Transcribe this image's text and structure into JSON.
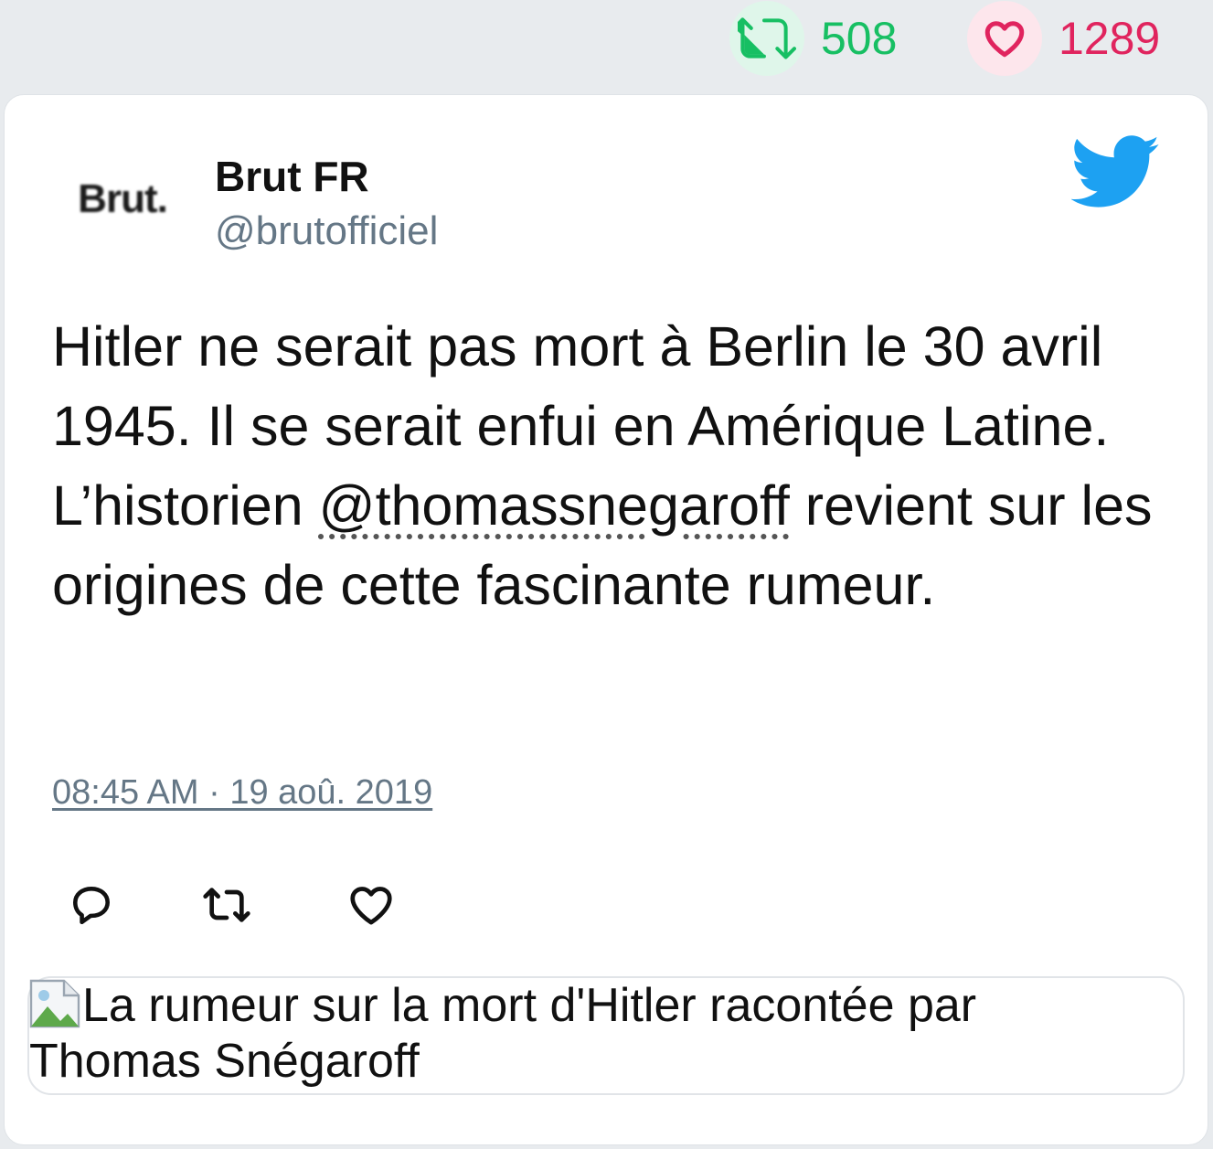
{
  "stats": {
    "retweets": "508",
    "likes": "1289",
    "retweet_icon": "retweet-icon",
    "like_icon": "heart-icon",
    "retweet_color": "#17bf63",
    "like_color": "#e0245e"
  },
  "tweet": {
    "avatar_text": "Brut.",
    "display_name": "Brut FR",
    "handle": "@brutofficiel",
    "text_before": "Hitler ne serait pas mort à Berlin le 30 avril 1945. Il se serait enfui en Amérique Latine. L’historien ",
    "mention": "@thomassnegaroff",
    "text_after": " revient sur les origines de cette fascinante rumeur.",
    "timestamp": "08:45 AM · 19 aoû. 2019",
    "brand_icon": "twitter-bird-icon",
    "brand_color": "#1da1f2"
  },
  "actions": {
    "reply_icon": "reply-icon",
    "retweet_icon": "retweet-icon",
    "like_icon": "heart-icon"
  },
  "media": {
    "alt_text": "La rumeur sur la mort d'Hitler racontée par Thomas Snégaroff"
  }
}
